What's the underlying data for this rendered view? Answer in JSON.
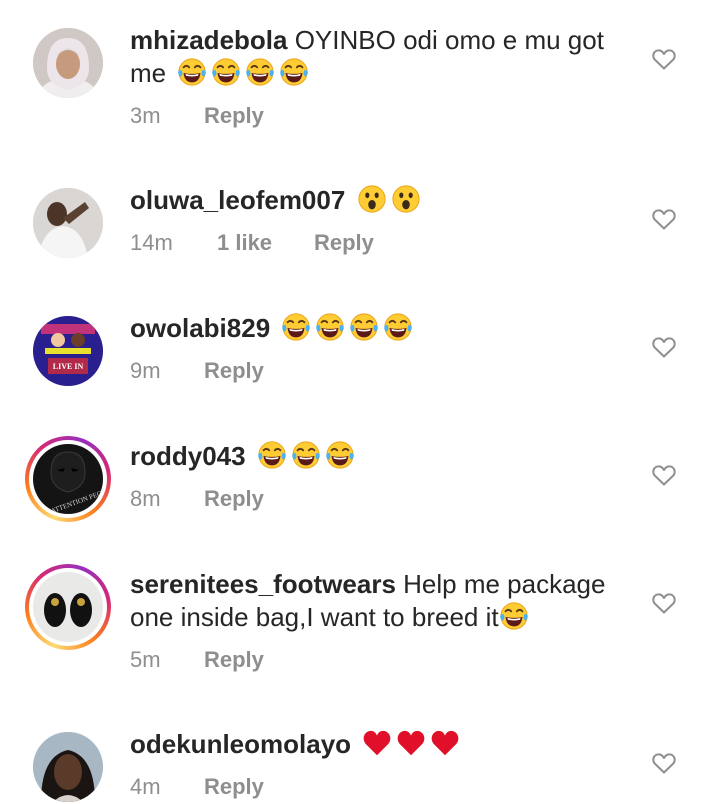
{
  "comments": [
    {
      "username": "mhizadebola",
      "text": " OYINBO odi omo e mu got me",
      "emojis": [
        "tears-of-joy",
        "tears-of-joy",
        "tears-of-joy",
        "tears-of-joy"
      ],
      "time": "3m",
      "likes": "",
      "reply": "Reply"
    },
    {
      "username": "oluwa_leofem007",
      "text": "",
      "emojis": [
        "astonished",
        "astonished"
      ],
      "time": "14m",
      "likes": "1 like",
      "reply": "Reply"
    },
    {
      "username": "owolabi829",
      "text": "",
      "emojis": [
        "tears-of-joy",
        "tears-of-joy",
        "tears-of-joy",
        "tears-of-joy"
      ],
      "time": "9m",
      "likes": "",
      "reply": "Reply"
    },
    {
      "username": "roddy043",
      "text": "",
      "emojis": [
        "tears-of-joy",
        "tears-of-joy",
        "tears-of-joy"
      ],
      "time": "8m",
      "likes": "",
      "reply": "Reply"
    },
    {
      "username": "serenitees_footwears",
      "text": " Help me package one inside bag,I want to breed it",
      "emojis": [
        "tears-of-joy"
      ],
      "time": "5m",
      "likes": "",
      "reply": "Reply"
    },
    {
      "username": "odekunleomolayo",
      "text": "",
      "emojis": [
        "red-heart",
        "red-heart",
        "red-heart"
      ],
      "time": "4m",
      "likes": "",
      "reply": "Reply"
    }
  ],
  "avatar_texts": {
    "roddy043": "ATTENTION PEOPLE",
    "owolabi829": "LIVE IN"
  },
  "colors": {
    "text": "#262626",
    "meta": "#8e8e8e",
    "heart_outline": "#8e8e8e",
    "emoji_face": "#FFCC33",
    "red_heart": "#E0102A"
  }
}
